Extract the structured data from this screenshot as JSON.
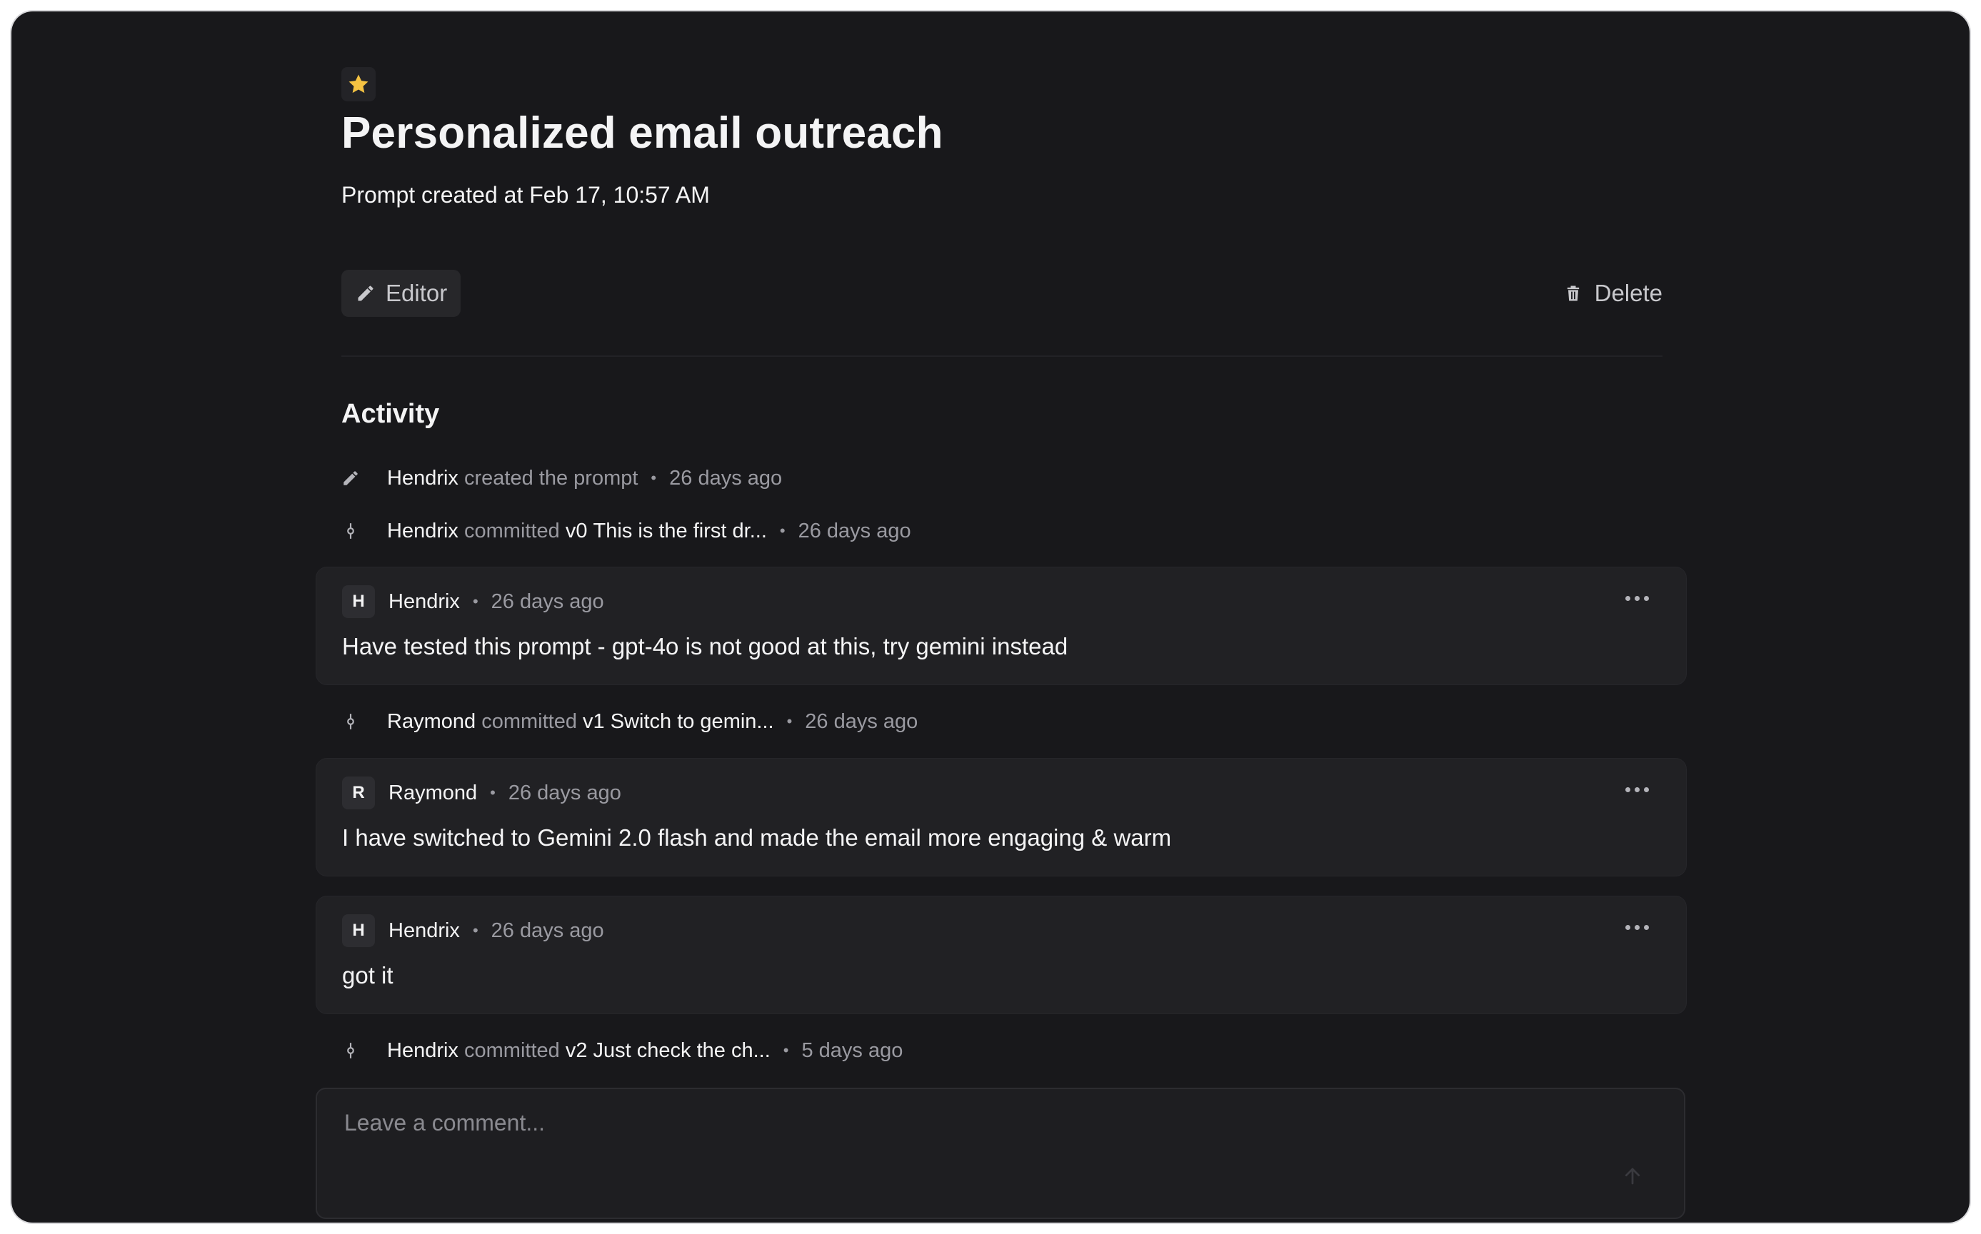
{
  "header": {
    "title": "Personalized email outreach",
    "subtitle": "Prompt created at Feb 17, 10:57 AM",
    "star_color": "#f5c242"
  },
  "toolbar": {
    "editor_label": "Editor",
    "editor_icon": "pencil-icon",
    "delete_label": "Delete",
    "delete_icon": "trash-icon"
  },
  "activity": {
    "title": "Activity",
    "events": [
      {
        "user": "Hendrix",
        "action": "created the prompt",
        "version": "",
        "message": "",
        "time": "26 days ago",
        "icon": "pencil-icon"
      },
      {
        "user": "Hendrix",
        "action": "committed",
        "version": "v0",
        "message": "This is the first dr...",
        "time": "26 days ago",
        "icon": "commit-icon"
      },
      {
        "user": "Raymond",
        "action": "committed",
        "version": "v1",
        "message": "Switch to gemin...",
        "time": "26 days ago",
        "icon": "commit-icon"
      },
      {
        "user": "Hendrix",
        "action": "committed",
        "version": "v2",
        "message": "Just check the ch...",
        "time": "5 days ago",
        "icon": "commit-icon"
      }
    ],
    "comments": [
      {
        "initial": "H",
        "user": "Hendrix",
        "time": "26 days ago",
        "text": "Have tested this prompt - gpt-4o is not good at this, try gemini instead"
      },
      {
        "initial": "R",
        "user": "Raymond",
        "time": "26 days ago",
        "text": "I have switched to Gemini 2.0 flash and made the email more engaging & warm"
      },
      {
        "initial": "H",
        "user": "Hendrix",
        "time": "26 days ago",
        "text": "got it"
      }
    ]
  },
  "comment_box": {
    "placeholder": "Leave a comment...",
    "value": ""
  }
}
